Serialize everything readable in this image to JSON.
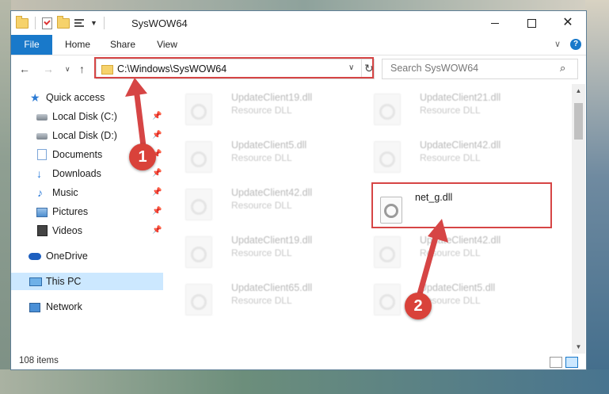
{
  "window": {
    "title": "SysWOW64",
    "minimize": "—",
    "maximize": "",
    "close": "✕"
  },
  "ribbon": {
    "tabs": [
      {
        "label": "File"
      },
      {
        "label": "Home"
      },
      {
        "label": "Share"
      },
      {
        "label": "View"
      }
    ],
    "help": "?"
  },
  "nav": {
    "back": "←",
    "forward": "→",
    "recent": "∨",
    "up": "↑"
  },
  "address": {
    "path": "C:\\Windows\\SysWOW64"
  },
  "search": {
    "placeholder": "Search SysWOW64"
  },
  "sidebar": {
    "items": [
      {
        "label": "Quick access",
        "icon": "star-icon",
        "pinned": false
      },
      {
        "label": "Local Disk (C:)",
        "icon": "disk-icon",
        "pinned": true
      },
      {
        "label": "Local Disk (D:)",
        "icon": "disk-icon",
        "pinned": true
      },
      {
        "label": "Documents",
        "icon": "documents-icon",
        "pinned": true
      },
      {
        "label": "Downloads",
        "icon": "downloads-icon",
        "pinned": true
      },
      {
        "label": "Music",
        "icon": "music-icon",
        "pinned": true
      },
      {
        "label": "Pictures",
        "icon": "pictures-icon",
        "pinned": true
      },
      {
        "label": "Videos",
        "icon": "videos-icon",
        "pinned": true
      },
      {
        "label": "OneDrive",
        "icon": "onedrive-icon",
        "pinned": false
      },
      {
        "label": "This PC",
        "icon": "this-pc-icon",
        "pinned": false,
        "selected": true
      },
      {
        "label": "Network",
        "icon": "network-icon",
        "pinned": false
      }
    ]
  },
  "files": [
    {
      "name": "UpdateClient19.dll",
      "type": "Resource DLL"
    },
    {
      "name": "UpdateClient21.dll",
      "type": "Resource DLL"
    },
    {
      "name": "UpdateClient5.dll",
      "type": "Resource DLL"
    },
    {
      "name": "UpdateClient42.dll",
      "type": "Resource DLL"
    },
    {
      "name": "UpdateClient42.dll",
      "type": "Resource DLL"
    },
    {
      "name": "net_g.dll",
      "type": "",
      "highlighted": true
    },
    {
      "name": "UpdateClient19.dll",
      "type": "Resource DLL"
    },
    {
      "name": "UpdateClient42.dll",
      "type": "Resource DLL"
    },
    {
      "name": "UpdateClient65.dll",
      "type": "Resource DLL"
    },
    {
      "name": "UpdateClient5.dll",
      "type": "Resource DLL"
    }
  ],
  "status": {
    "item_count": "108 items"
  },
  "annotations": {
    "step1": "1",
    "step2": "2",
    "color": "#d64545"
  }
}
